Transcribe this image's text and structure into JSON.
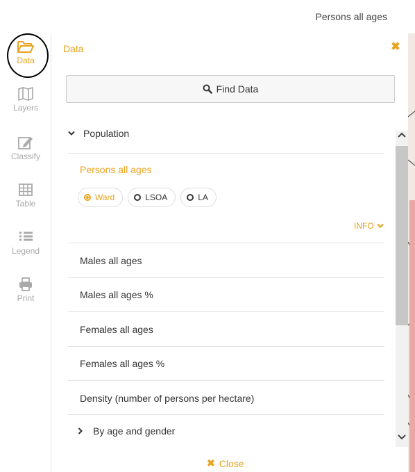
{
  "top": {
    "title": "Persons all ages"
  },
  "rail": {
    "items": [
      {
        "label": "Data",
        "icon": "folder-open-icon",
        "active": true
      },
      {
        "label": "Layers",
        "icon": "map-icon",
        "active": false
      },
      {
        "label": "Classify",
        "icon": "edit-icon",
        "active": false
      },
      {
        "label": "Table",
        "icon": "table-icon",
        "active": false
      },
      {
        "label": "Legend",
        "icon": "list-icon",
        "active": false
      },
      {
        "label": "Print",
        "icon": "printer-icon",
        "active": false
      }
    ]
  },
  "panel": {
    "title": "Data",
    "find_label": "Find Data",
    "section": "Population",
    "selected_indicator": "Persons all ages",
    "geographies": [
      {
        "label": "Ward",
        "selected": true
      },
      {
        "label": "LSOA",
        "selected": false
      },
      {
        "label": "LA",
        "selected": false
      }
    ],
    "info_label": "INFO",
    "items": [
      "Males all ages",
      "Males all ages %",
      "Females all ages",
      "Females all ages %",
      "Density (number of persons per hectare)"
    ],
    "subsection": "By age and gender",
    "close_label": "Close"
  },
  "colors": {
    "accent": "#e8a320",
    "text": "#333333",
    "muted": "#a9a9a9"
  }
}
